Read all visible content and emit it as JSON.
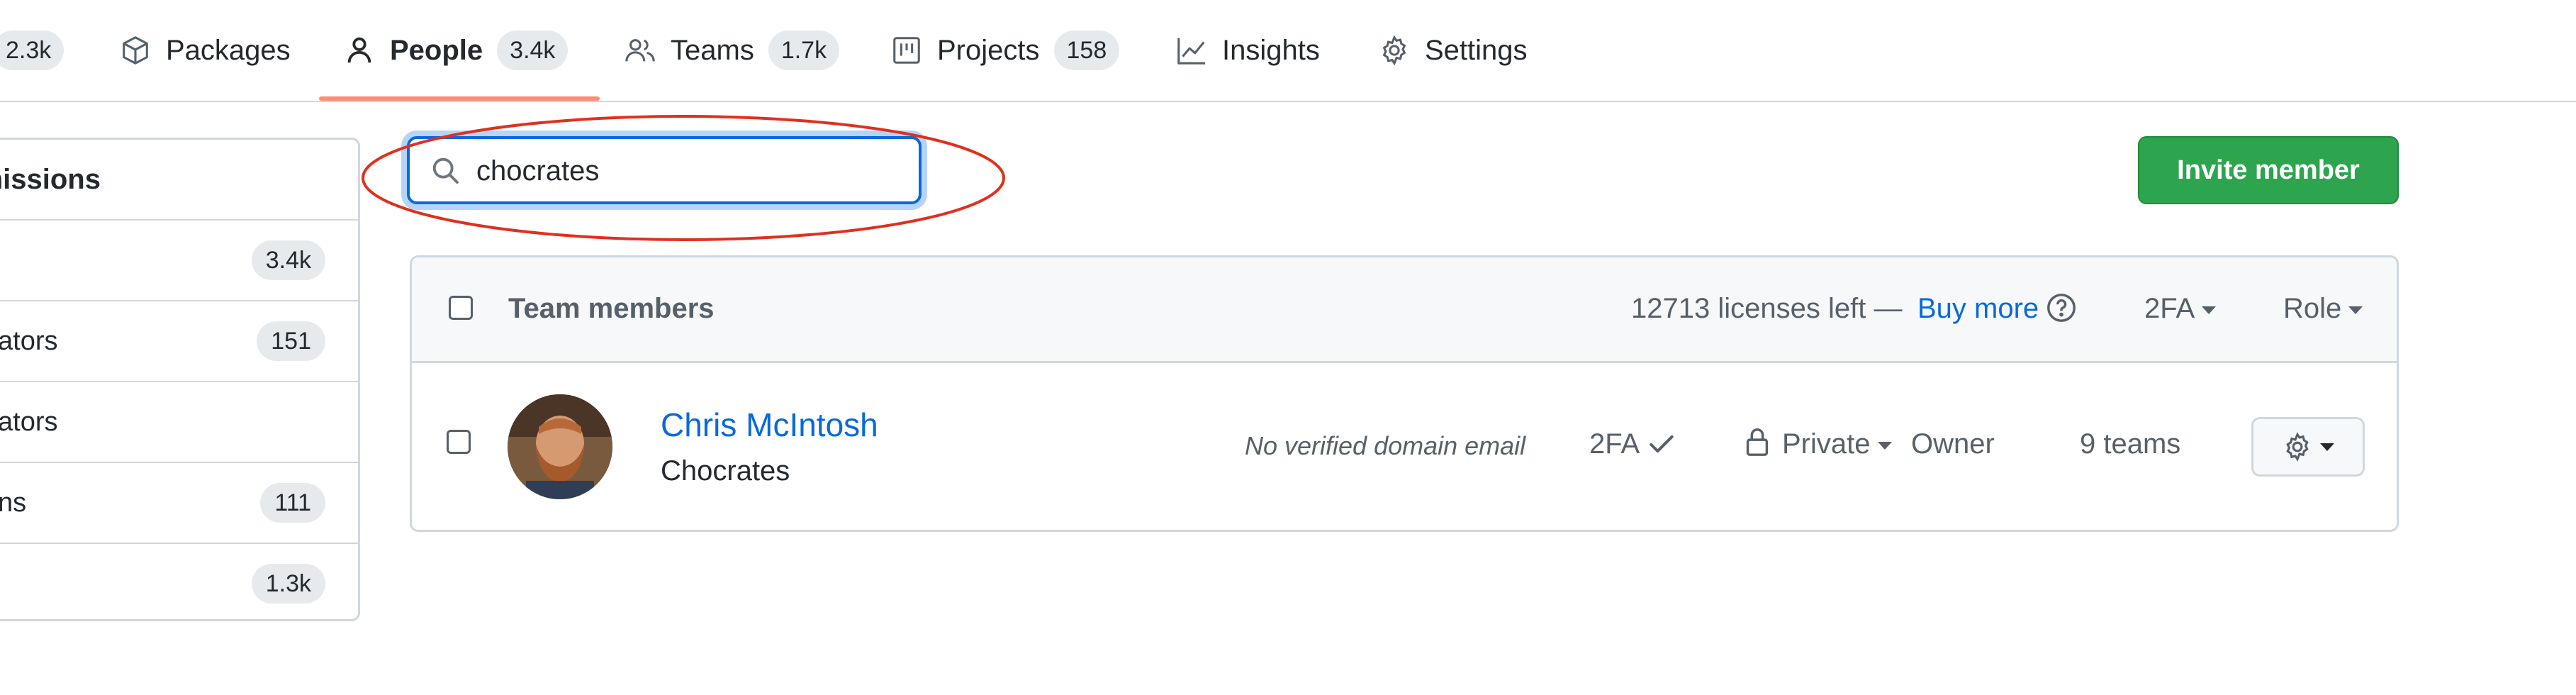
{
  "nav": {
    "repos_count": "2.3k",
    "packages": {
      "label": "Packages",
      "icon": "package-icon"
    },
    "people": {
      "label": "People",
      "count": "3.4k",
      "icon": "person-icon"
    },
    "teams": {
      "label": "Teams",
      "count": "1.7k",
      "icon": "people-icon"
    },
    "projects": {
      "label": "Projects",
      "count": "158",
      "icon": "project-icon"
    },
    "insights": {
      "label": "Insights",
      "icon": "graph-icon"
    },
    "settings": {
      "label": "Settings",
      "icon": "gear-icon"
    },
    "active_accent": "#fd8c73"
  },
  "sidebar": {
    "heading": "rmissions",
    "items": [
      {
        "label": "",
        "count": "3.4k"
      },
      {
        "label": "ators",
        "count": "151"
      },
      {
        "label": "ators",
        "count": ""
      },
      {
        "label": "ns",
        "count": "111"
      },
      {
        "label": "",
        "count": "1.3k"
      }
    ]
  },
  "search": {
    "value": "chocrates",
    "placeholder": ""
  },
  "invite_button": {
    "label": "Invite member",
    "color": "#2da44e"
  },
  "members": {
    "header_title": "Team members",
    "licenses_text": "12713 licenses left —",
    "buy_more": "Buy more",
    "help_icon": "question-icon",
    "filter_2fa": "2FA",
    "filter_role": "Role",
    "rows": [
      {
        "name": "Chris McIntosh",
        "username": "Chocrates",
        "email_note": "No verified domain email",
        "twofa": "2FA",
        "visibility": "Private",
        "role": "Owner",
        "teams": "9 teams"
      }
    ]
  },
  "annotation": {
    "color": "#e0301e"
  }
}
